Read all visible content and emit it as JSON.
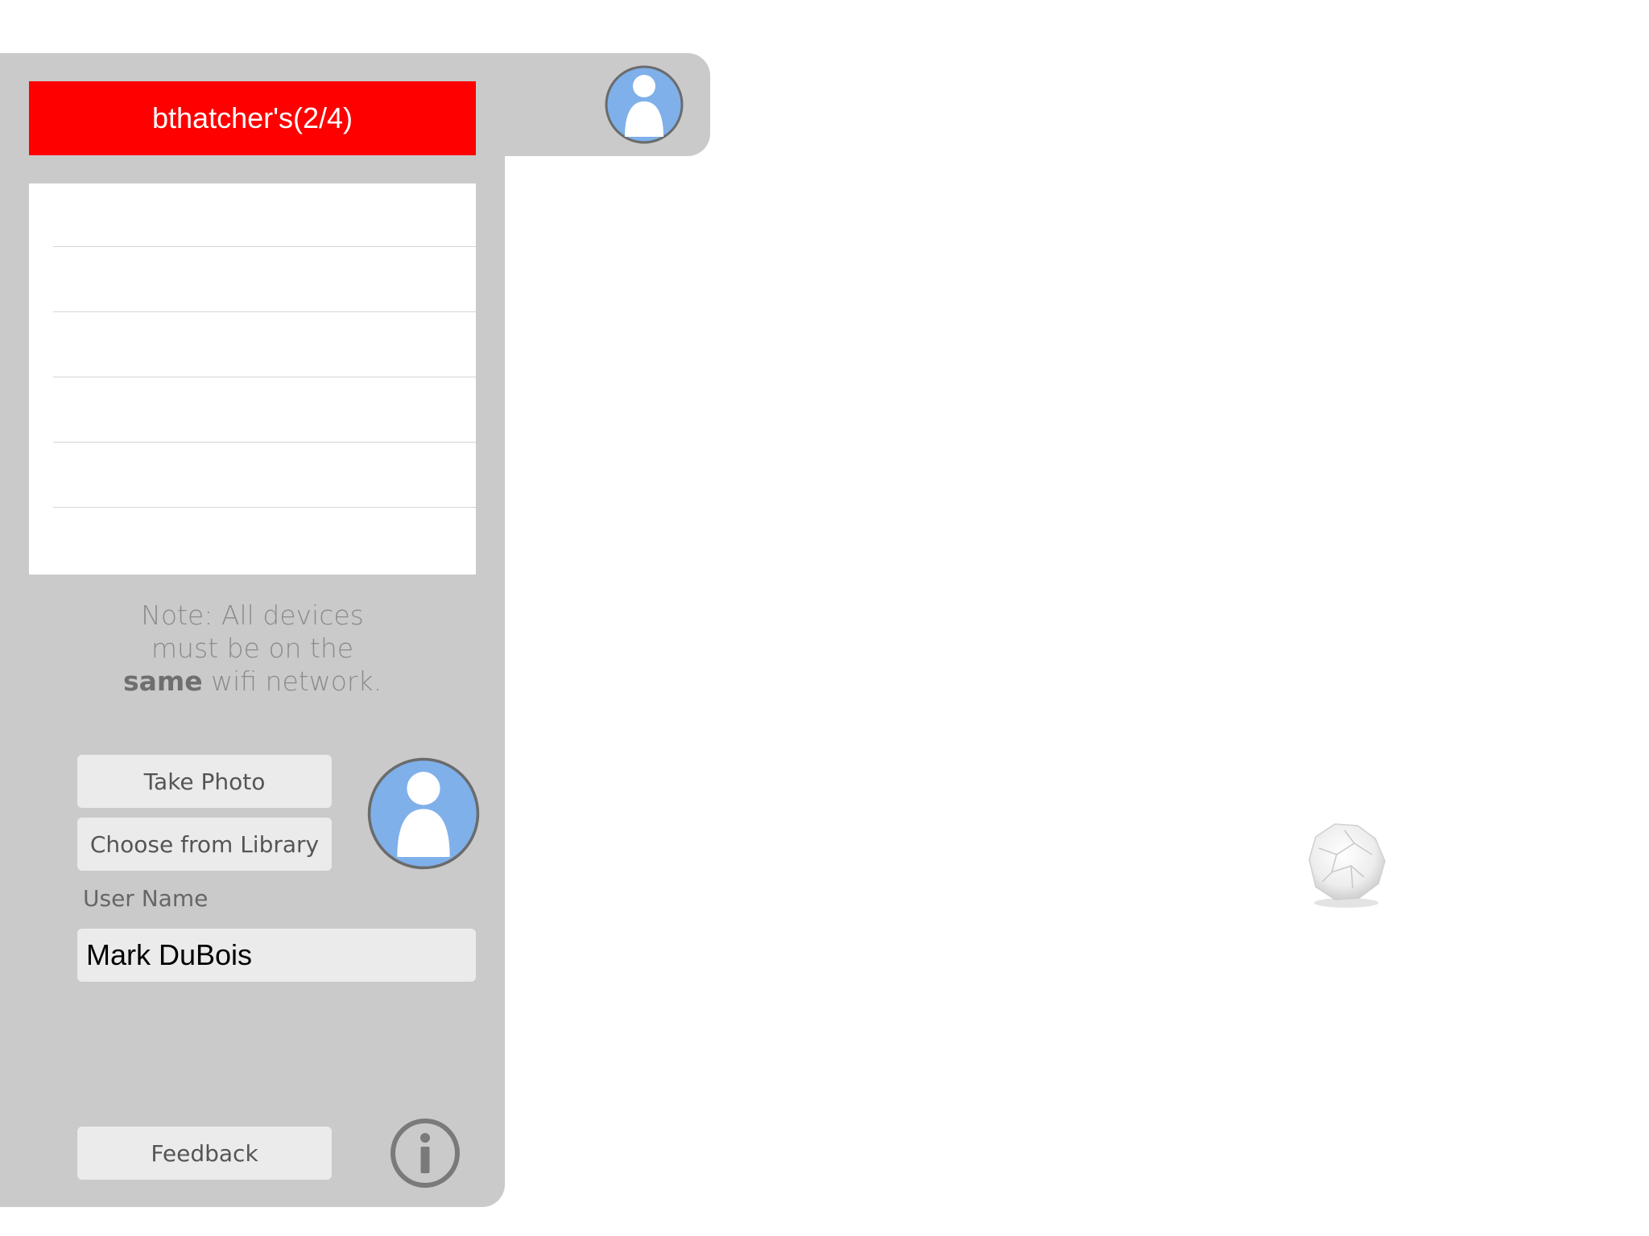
{
  "header": {
    "session_title": "bthatcher's(2/4)",
    "avatar_icon": "user-avatar-icon"
  },
  "device_list": {
    "rows": [
      "",
      "",
      "",
      "",
      "",
      ""
    ]
  },
  "note": {
    "line1": "Note: All devices",
    "line2": "must be on the",
    "line3_bold": "same",
    "line3_rest": " wifi network."
  },
  "profile": {
    "take_photo_label": "Take Photo",
    "choose_library_label": "Choose from Library",
    "user_name_label": "User Name",
    "user_name_value": "Mark DuBois",
    "avatar_icon": "user-avatar-icon"
  },
  "footer": {
    "feedback_label": "Feedback",
    "info_icon": "info-icon"
  },
  "canvas": {
    "paper_ball_icon": "crumpled-paper-icon"
  },
  "colors": {
    "banner": "#ff0000",
    "panel": "#cacaca",
    "avatar_fill": "#7fb0ea",
    "avatar_ring": "#6b6b6b"
  }
}
